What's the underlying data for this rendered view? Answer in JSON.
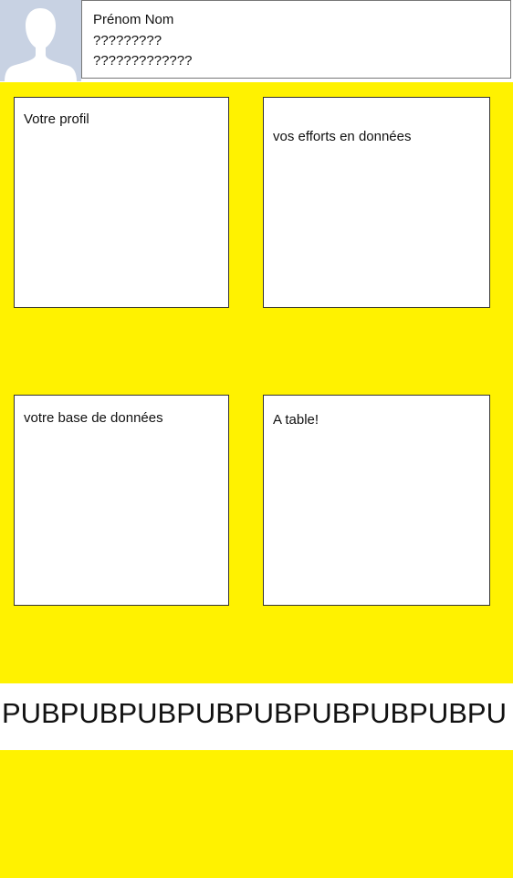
{
  "profile_header": {
    "avatar_icon": "user-silhouette-icon",
    "name": "Prénom Nom",
    "line2": "?????????",
    "line3": "?????????????"
  },
  "cards": {
    "profile": "Votre profil",
    "efforts": "vos efforts en données",
    "database": "votre base de données",
    "table": "A table!"
  },
  "ad_banner": {
    "text": "PUBPUBPUBPUBPUBPUBPUBPUBPU"
  },
  "colors": {
    "background_accent": "#fff200",
    "card_background": "#ffffff",
    "avatar_background": "#c8d2e3"
  }
}
